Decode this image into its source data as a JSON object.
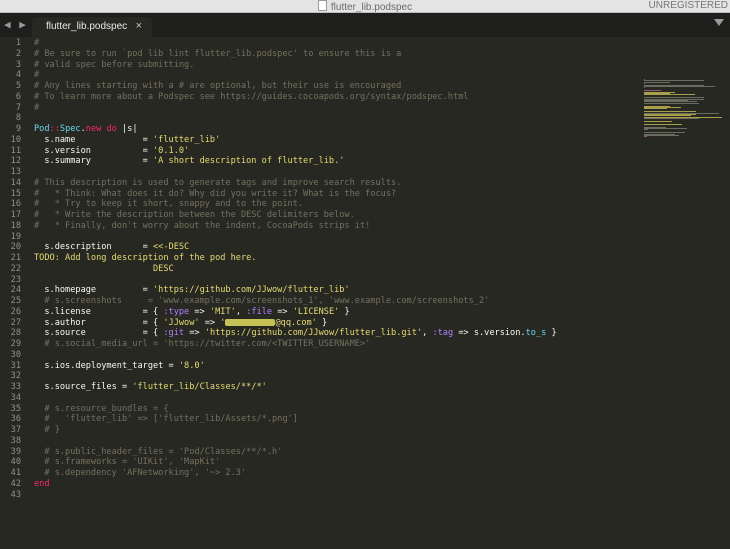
{
  "window": {
    "title": "flutter_lib.podspec",
    "unregistered": "UNREGISTERED"
  },
  "tabbar": {
    "nav_arrows": "◀ ▶",
    "active_tab": "flutter_lib.podspec",
    "close": "×"
  },
  "editor": {
    "lines": [
      {
        "n": "1",
        "p": [
          [
            "c",
            "#"
          ]
        ]
      },
      {
        "n": "2",
        "p": [
          [
            "c",
            "# Be sure to run `pod lib lint flutter_lib.podspec' to ensure this is a"
          ]
        ]
      },
      {
        "n": "3",
        "p": [
          [
            "c",
            "# valid spec before submitting."
          ]
        ]
      },
      {
        "n": "4",
        "p": [
          [
            "c",
            "#"
          ]
        ]
      },
      {
        "n": "5",
        "p": [
          [
            "c",
            "# Any lines starting with a # are optional, but their use is encouraged"
          ]
        ]
      },
      {
        "n": "6",
        "p": [
          [
            "c",
            "# To learn more about a Podspec see https://guides.cocoapods.org/syntax/podspec.html"
          ]
        ]
      },
      {
        "n": "7",
        "p": [
          [
            "c",
            "#"
          ]
        ]
      },
      {
        "n": "8",
        "p": []
      },
      {
        "n": "9",
        "p": [
          [
            "t",
            "Pod"
          ],
          [
            "k",
            "::"
          ],
          [
            "t",
            "Spec"
          ],
          [
            "",
            "."
          ],
          [
            "k",
            "new"
          ],
          [
            "",
            " "
          ],
          [
            "k",
            "do"
          ],
          [
            "",
            " |"
          ],
          [
            "",
            "s"
          ],
          [
            "",
            "|"
          ]
        ]
      },
      {
        "n": "10",
        "p": [
          [
            "",
            "  s.name             = "
          ],
          [
            "s",
            "'flutter_lib'"
          ]
        ]
      },
      {
        "n": "11",
        "p": [
          [
            "",
            "  s.version          = "
          ],
          [
            "s",
            "'0.1.0'"
          ]
        ]
      },
      {
        "n": "12",
        "p": [
          [
            "",
            "  s.summary          = "
          ],
          [
            "s",
            "'A short description of flutter_lib.'"
          ]
        ]
      },
      {
        "n": "13",
        "p": []
      },
      {
        "n": "14",
        "p": [
          [
            "c",
            "# This description is used to generate tags and improve search results."
          ]
        ]
      },
      {
        "n": "15",
        "p": [
          [
            "c",
            "#   * Think: What does it do? Why did you write it? What is the focus?"
          ]
        ]
      },
      {
        "n": "16",
        "p": [
          [
            "c",
            "#   * Try to keep it short, snappy and to the point."
          ]
        ]
      },
      {
        "n": "17",
        "p": [
          [
            "c",
            "#   * Write the description between the DESC delimiters below."
          ]
        ]
      },
      {
        "n": "18",
        "p": [
          [
            "c",
            "#   * Finally, don't worry about the indent, CocoaPods strips it!"
          ]
        ]
      },
      {
        "n": "19",
        "p": []
      },
      {
        "n": "20",
        "p": [
          [
            "",
            "  s.description      = "
          ],
          [
            "s",
            "<<-DESC"
          ]
        ]
      },
      {
        "n": "21",
        "p": [
          [
            "hl",
            "TODO: Add long description of the pod here."
          ]
        ]
      },
      {
        "n": "22",
        "p": [
          [
            "s",
            "                       DESC"
          ]
        ]
      },
      {
        "n": "23",
        "p": []
      },
      {
        "n": "24",
        "p": [
          [
            "",
            "  s.homepage         = "
          ],
          [
            "s",
            "'https://github.com/JJwow/flutter_lib'"
          ]
        ]
      },
      {
        "n": "25",
        "p": [
          [
            "c",
            "  # s.screenshots     = 'www.example.com/screenshots_1', 'www.example.com/screenshots_2'"
          ]
        ]
      },
      {
        "n": "26",
        "p": [
          [
            "",
            "  s.license          = { "
          ],
          [
            "sym",
            ":type"
          ],
          [
            "",
            " => "
          ],
          [
            "s",
            "'MIT'"
          ],
          [
            "",
            ", "
          ],
          [
            "sym",
            ":file"
          ],
          [
            "",
            " => "
          ],
          [
            "s",
            "'LICENSE'"
          ],
          [
            "",
            " }"
          ]
        ]
      },
      {
        "n": "27",
        "p": [
          [
            "",
            "  s.author           = { "
          ],
          [
            "s",
            "'JJwow'"
          ],
          [
            "",
            " => "
          ],
          [
            "s",
            "'"
          ],
          [
            "redact",
            ""
          ],
          [
            "s",
            "@qq.com'"
          ],
          [
            "",
            " }"
          ]
        ]
      },
      {
        "n": "28",
        "p": [
          [
            "",
            "  s.source           = { "
          ],
          [
            "sym",
            ":git"
          ],
          [
            "",
            " => "
          ],
          [
            "s",
            "'https://github.com/JJwow/flutter_lib.git'"
          ],
          [
            "",
            ", "
          ],
          [
            "sym",
            ":tag"
          ],
          [
            "",
            " => s.version."
          ],
          [
            "t",
            "to_s"
          ],
          [
            "",
            " }"
          ]
        ]
      },
      {
        "n": "29",
        "p": [
          [
            "c",
            "  # s.social_media_url = 'https://twitter.com/<TWITTER_USERNAME>'"
          ]
        ]
      },
      {
        "n": "30",
        "p": []
      },
      {
        "n": "31",
        "p": [
          [
            "",
            "  s.ios.deployment_target = "
          ],
          [
            "s",
            "'8.0'"
          ]
        ]
      },
      {
        "n": "32",
        "p": []
      },
      {
        "n": "33",
        "p": [
          [
            "",
            "  s.source_files = "
          ],
          [
            "s",
            "'flutter_lib/Classes/**/*'"
          ]
        ]
      },
      {
        "n": "34",
        "p": []
      },
      {
        "n": "35",
        "p": [
          [
            "c",
            "  # s.resource_bundles = {"
          ]
        ]
      },
      {
        "n": "36",
        "p": [
          [
            "c",
            "  #   'flutter_lib' => ['flutter_lib/Assets/*.png']"
          ]
        ]
      },
      {
        "n": "37",
        "p": [
          [
            "c",
            "  # }"
          ]
        ]
      },
      {
        "n": "38",
        "p": []
      },
      {
        "n": "39",
        "p": [
          [
            "c",
            "  # s.public_header_files = 'Pod/Classes/**/*.h'"
          ]
        ]
      },
      {
        "n": "40",
        "p": [
          [
            "c",
            "  # s.frameworks = 'UIKit', 'MapKit'"
          ]
        ]
      },
      {
        "n": "41",
        "p": [
          [
            "c",
            "  # s.dependency 'AFNetworking', '~> 2.3'"
          ]
        ]
      },
      {
        "n": "42",
        "p": [
          [
            "k",
            "end"
          ]
        ]
      },
      {
        "n": "43",
        "p": []
      }
    ]
  }
}
